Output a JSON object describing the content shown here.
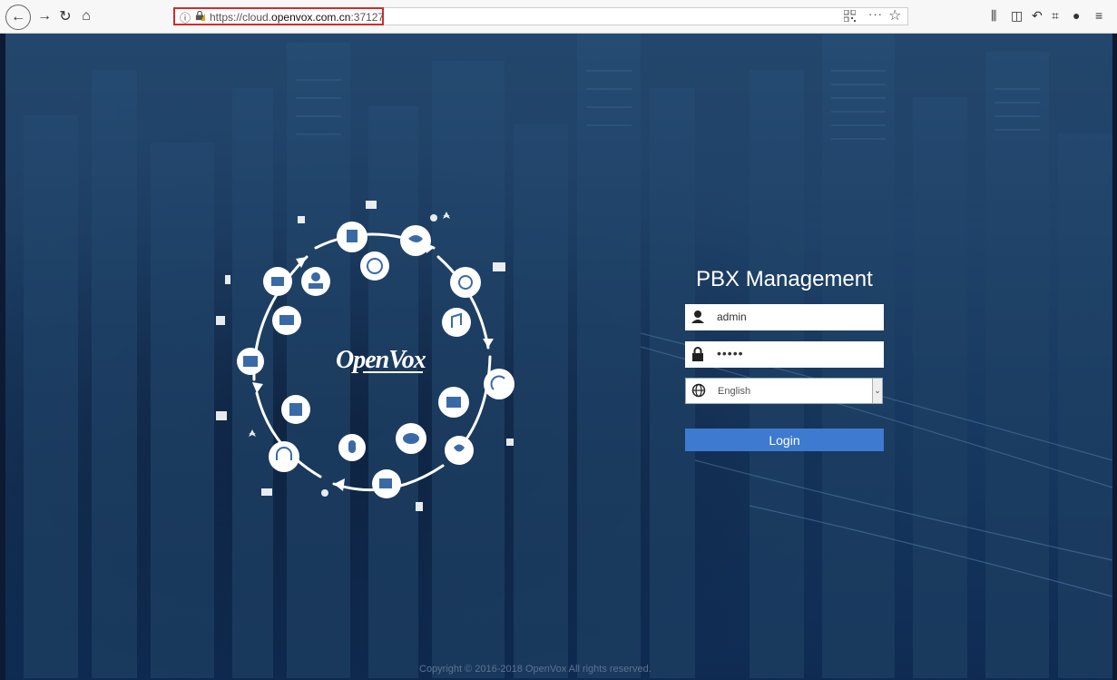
{
  "browser": {
    "url_prefix": "https://cloud.",
    "url_domain": "openvox.com.cn",
    "url_suffix": ":37127",
    "more_label": "···",
    "star_label": "☆"
  },
  "icons": {
    "back": "back-arrow-icon",
    "forward": "forward-arrow-icon",
    "reload": "reload-icon",
    "home": "home-icon",
    "info": "info-icon",
    "lock": "insecure-lock-icon",
    "qr": "qr-code-icon",
    "library": "library-icon",
    "sidebar": "sidebar-icon",
    "undo": "undo-icon",
    "screenshot": "screenshot-icon",
    "chat": "chat-icon",
    "menu": "hamburger-menu-icon"
  },
  "logo": {
    "text": "OpenVox"
  },
  "login": {
    "title": "PBX Management",
    "username": "admin",
    "password_mask": "•••••",
    "language": "English",
    "login_label": "Login"
  },
  "footer": {
    "copyright": "Copyright © 2016-2018 OpenVox All rights reserved."
  },
  "colors": {
    "accent": "#3e7ad0",
    "url_highlight": "#d42b2b",
    "background": "#163a64"
  }
}
